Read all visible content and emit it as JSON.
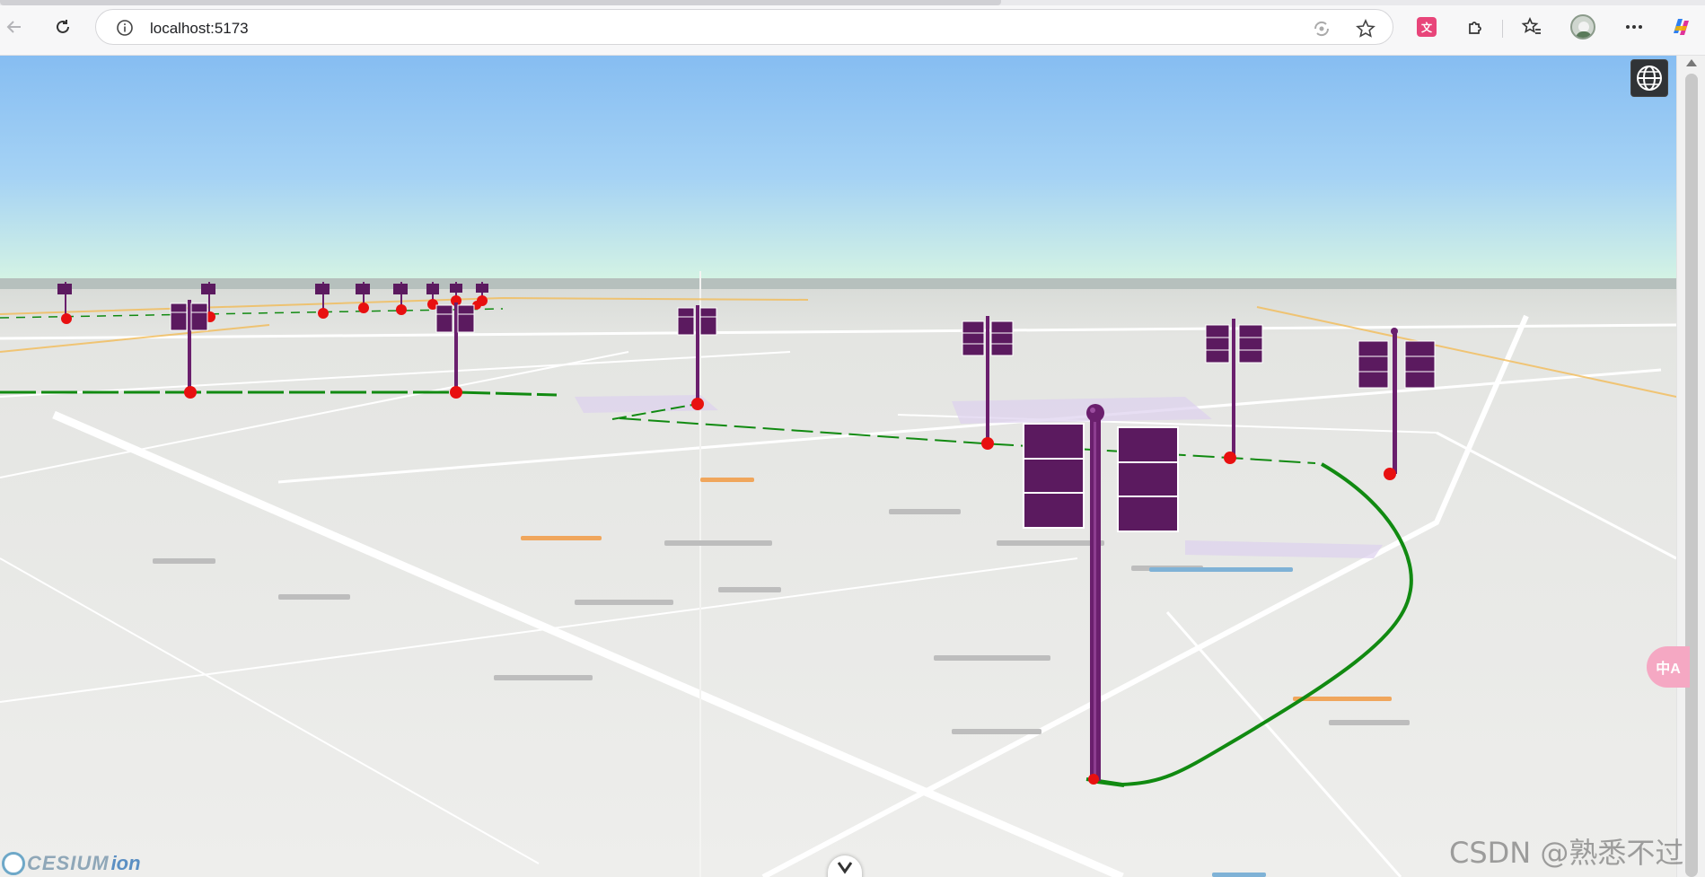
{
  "browser": {
    "url": "localhost:5173",
    "icons": [
      "back-icon",
      "reload-icon",
      "site-info-icon",
      "tracking-icon",
      "favorite-star-icon",
      "translate-extension-icon",
      "extensions-puzzle-icon",
      "favorites-icon",
      "profile-avatar",
      "more-icon",
      "copilot-icon"
    ]
  },
  "viewer": {
    "logo_word": "CESIUM",
    "logo_ion": "ion",
    "globe_button": "globe-icon",
    "expand_button": "chevron-down-icon",
    "translate_fab": "中A",
    "watermark": "CSDN @熟悉不过"
  },
  "colors": {
    "sky_top": "#86bdf2",
    "sky_bottom": "#d4f3e4",
    "ground": "#ececea",
    "route_line": "#118a11",
    "pole": "#6a1f6d",
    "sign_board": "#5b1a5f",
    "marker": "#e81010"
  }
}
